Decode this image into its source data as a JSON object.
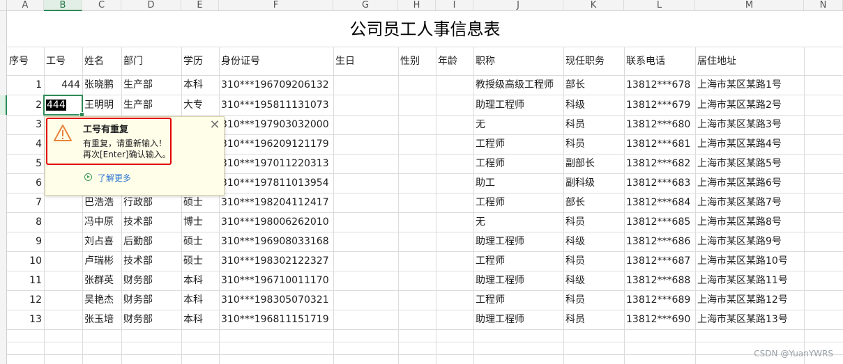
{
  "columns": [
    "A",
    "B",
    "C",
    "D",
    "E",
    "F",
    "G",
    "H",
    "I",
    "J",
    "K",
    "L",
    "M",
    "N"
  ],
  "selected_column": "B",
  "title": "公司员工人事信息表",
  "headers": [
    "序号",
    "工号",
    "姓名",
    "部门",
    "学历",
    "身份证号",
    "生日",
    "性别",
    "年龄",
    "职称",
    "现任职务",
    "联系电话",
    "居住地址"
  ],
  "rows": [
    {
      "seq": "1",
      "id": "444",
      "name": "张晓鹏",
      "dept": "生产部",
      "edu": "本科",
      "idno": "310***196709206132",
      "title": "教授级高级工程师",
      "post": "部长",
      "phone": "13812***678",
      "addr": "上海市某区某路1号"
    },
    {
      "seq": "2",
      "id": "444",
      "name": "王明明",
      "dept": "生产部",
      "edu": "大专",
      "idno": "310***195811131073",
      "title": "助理工程师",
      "post": "科级",
      "phone": "13812***679",
      "addr": "上海市某区某路2号"
    },
    {
      "seq": "3",
      "id": "",
      "name": "",
      "dept": "",
      "edu": "",
      "idno": "310***197903032000",
      "title": "无",
      "post": "科员",
      "phone": "13812***680",
      "addr": "上海市某区某路3号"
    },
    {
      "seq": "4",
      "id": "",
      "name": "",
      "dept": "",
      "edu": "",
      "idno": "310***196209121179",
      "title": "工程师",
      "post": "科员",
      "phone": "13812***681",
      "addr": "上海市某区某路4号"
    },
    {
      "seq": "5",
      "id": "",
      "name": "",
      "dept": "",
      "edu": "",
      "idno": "310***197011220313",
      "title": "工程师",
      "post": "副部长",
      "phone": "13812***682",
      "addr": "上海市某区某路5号"
    },
    {
      "seq": "6",
      "id": "",
      "name": "",
      "dept": "",
      "edu": "",
      "idno": "310***197811013954",
      "title": "助工",
      "post": "副科级",
      "phone": "13812***683",
      "addr": "上海市某区某路6号"
    },
    {
      "seq": "7",
      "id": "",
      "name": "巴浩浩",
      "dept": "行政部",
      "edu": "硕士",
      "idno": "310***198204112417",
      "title": "工程师",
      "post": "部长",
      "phone": "13812***684",
      "addr": "上海市某区某路7号"
    },
    {
      "seq": "8",
      "id": "",
      "name": "冯中原",
      "dept": "技术部",
      "edu": "博士",
      "idno": "310***198006262010",
      "title": "无",
      "post": "科员",
      "phone": "13812***685",
      "addr": "上海市某区某路8号"
    },
    {
      "seq": "9",
      "id": "",
      "name": "刘占喜",
      "dept": "后勤部",
      "edu": "硕士",
      "idno": "310***196908033168",
      "title": "助理工程师",
      "post": "科级",
      "phone": "13812***686",
      "addr": "上海市某区某路9号"
    },
    {
      "seq": "10",
      "id": "",
      "name": "卢瑞彬",
      "dept": "技术部",
      "edu": "硕士",
      "idno": "310***198302122327",
      "title": "工程师",
      "post": "科员",
      "phone": "13812***687",
      "addr": "上海市某区某路10号"
    },
    {
      "seq": "11",
      "id": "",
      "name": "张群英",
      "dept": "财务部",
      "edu": "本科",
      "idno": "310***196710011170",
      "title": "助理工程师",
      "post": "科级",
      "phone": "13812***688",
      "addr": "上海市某区某路11号"
    },
    {
      "seq": "12",
      "id": "",
      "name": "吴艳杰",
      "dept": "财务部",
      "edu": "本科",
      "idno": "310***198305070321",
      "title": "工程师",
      "post": "科员",
      "phone": "13812***689",
      "addr": "上海市某区某路12号"
    },
    {
      "seq": "13",
      "id": "",
      "name": "张玉培",
      "dept": "财务部",
      "edu": "本科",
      "idno": "310***196811151719",
      "title": "助理工程师",
      "post": "科员",
      "phone": "13812***690",
      "addr": "上海市某区某路13号"
    }
  ],
  "tooltip": {
    "title": "工号有重复",
    "line1": "有重复，请重新输入！",
    "line2": "再次[Enter]确认输入。",
    "link": "了解更多",
    "icon": "warning-triangle-icon"
  },
  "watermark": "CSDN @YuanYWRS",
  "colors": {
    "selection": "#2e8b57",
    "tooltip_border": "#e00000",
    "tooltip_bg": "#fffee9",
    "link": "#2b74d0"
  }
}
